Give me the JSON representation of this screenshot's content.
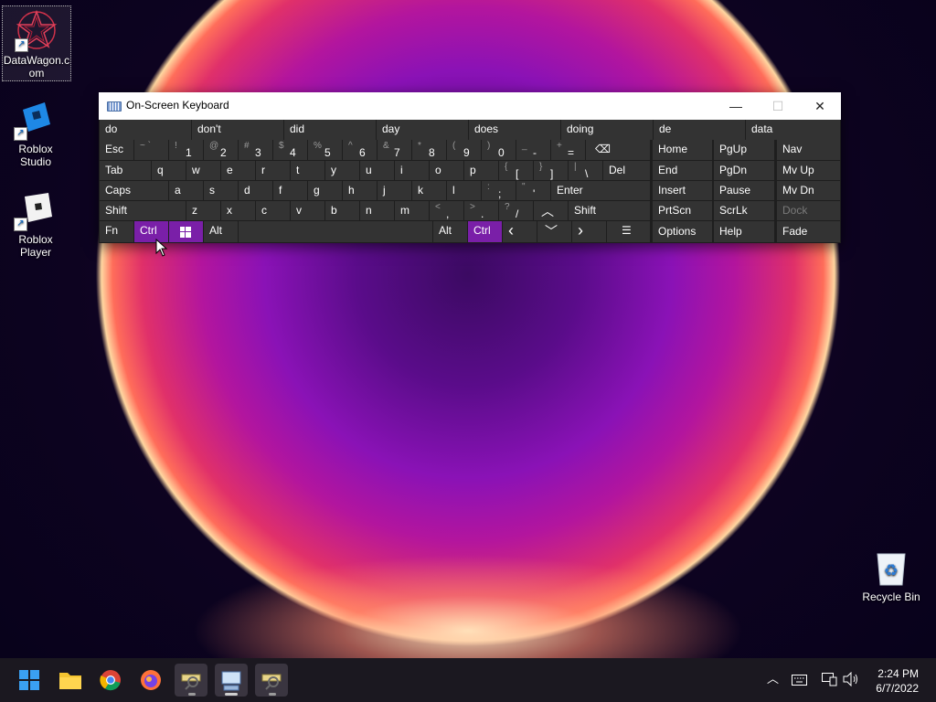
{
  "desktop": {
    "icons": [
      {
        "label": "DataWagon.c om"
      },
      {
        "label": "Roblox Studio"
      },
      {
        "label": "Roblox Player"
      },
      {
        "label": "Recycle Bin"
      }
    ]
  },
  "osk": {
    "title": "On-Screen Keyboard",
    "controls": {
      "minimize": "—",
      "maximize": "☐",
      "close": "✕"
    },
    "predictions": [
      "do",
      "don't",
      "did",
      "day",
      "does",
      "doing",
      "de",
      "data"
    ],
    "row1": {
      "esc": "Esc",
      "keys": [
        {
          "sup": "~ `",
          "main": ""
        },
        {
          "sup": "!",
          "main": "1"
        },
        {
          "sup": "@",
          "main": "2"
        },
        {
          "sup": "#",
          "main": "3"
        },
        {
          "sup": "$",
          "main": "4"
        },
        {
          "sup": "%",
          "main": "5"
        },
        {
          "sup": "^",
          "main": "6"
        },
        {
          "sup": "&",
          "main": "7"
        },
        {
          "sup": "*",
          "main": "8"
        },
        {
          "sup": "(",
          "main": "9"
        },
        {
          "sup": ")",
          "main": "0"
        },
        {
          "sup": "_",
          "main": "-"
        },
        {
          "sup": "+",
          "main": "="
        }
      ],
      "backspace": "⌫"
    },
    "row2": {
      "tab": "Tab",
      "letters": [
        "q",
        "w",
        "e",
        "r",
        "t",
        "y",
        "u",
        "i",
        "o",
        "p"
      ],
      "brackets": [
        {
          "sup": "{",
          "main": "["
        },
        {
          "sup": "}",
          "main": "]"
        },
        {
          "sup": "|",
          "main": "\\"
        }
      ],
      "del": "Del"
    },
    "row3": {
      "caps": "Caps",
      "letters": [
        "a",
        "s",
        "d",
        "f",
        "g",
        "h",
        "j",
        "k",
        "l"
      ],
      "punct": [
        {
          "sup": ":",
          "main": ";"
        },
        {
          "sup": "\"",
          "main": "'"
        }
      ],
      "enter": "Enter"
    },
    "row4": {
      "shift": "Shift",
      "letters": [
        "z",
        "x",
        "c",
        "v",
        "b",
        "n",
        "m"
      ],
      "punct": [
        {
          "sup": "<",
          "main": ","
        },
        {
          "sup": ">",
          "main": "."
        },
        {
          "sup": "?",
          "main": "/"
        }
      ],
      "up": "︿",
      "shift_right": "Shift"
    },
    "row5": {
      "fn": "Fn",
      "ctrl": "Ctrl",
      "alt": "Alt",
      "alt_right": "Alt",
      "ctrl_right": "Ctrl",
      "left": "‹",
      "down": "﹀",
      "right": "›",
      "menu": "☰"
    },
    "nav": {
      "rows": [
        [
          "Home",
          "PgUp",
          "Nav"
        ],
        [
          "End",
          "PgDn",
          "Mv Up"
        ],
        [
          "Insert",
          "Pause",
          "Mv Dn"
        ],
        [
          "PrtScn",
          "ScrLk",
          "Dock"
        ],
        [
          "Options",
          "Help",
          "Fade"
        ]
      ]
    }
  },
  "taskbar": {
    "clock": {
      "time": "2:24 PM",
      "date": "6/7/2022"
    },
    "tray": {
      "chevron": "︿"
    }
  },
  "colors": {
    "accent_purple": "#7a1fa8",
    "key_bg": "#333333",
    "osk_bg": "#1e1e1e"
  }
}
